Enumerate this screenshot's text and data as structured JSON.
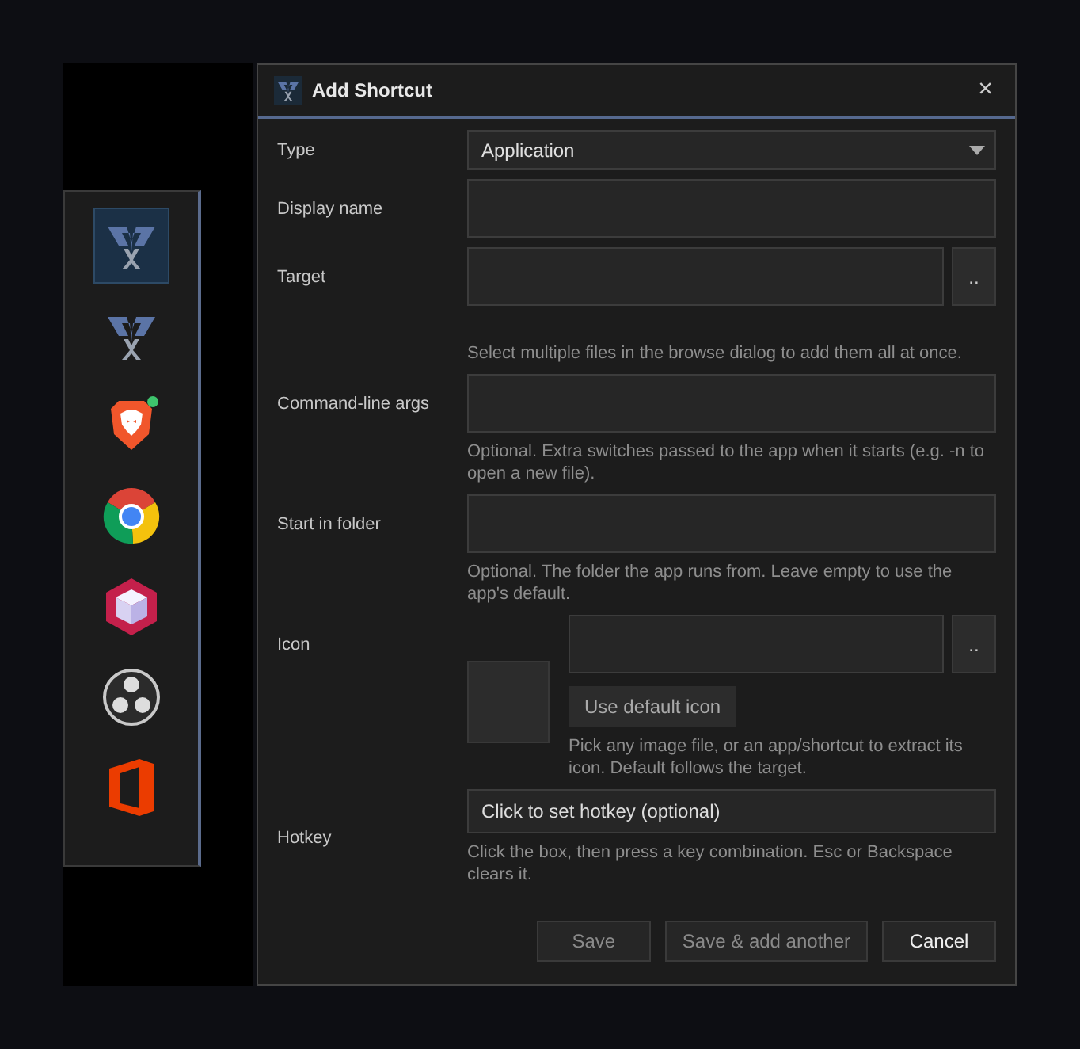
{
  "dock": {
    "items": [
      {
        "kind": "logo",
        "selected": true,
        "notification": false
      },
      {
        "kind": "logo",
        "selected": false,
        "notification": false
      },
      {
        "kind": "lion",
        "selected": false,
        "notification": true
      },
      {
        "kind": "chrome",
        "selected": false,
        "notification": false
      },
      {
        "kind": "cube",
        "selected": false,
        "notification": false
      },
      {
        "kind": "obs",
        "selected": false,
        "notification": false
      },
      {
        "kind": "office",
        "selected": false,
        "notification": false
      }
    ]
  },
  "dialog": {
    "title": "Add Shortcut",
    "close": "×",
    "fields": [
      {
        "kind": "select",
        "label": "Type",
        "value": "Application"
      },
      {
        "kind": "text",
        "label": "Display name"
      },
      {
        "kind": "browse",
        "label": "Target",
        "browse": "..",
        "hint": "Select multiple files in the browse dialog to add them all at once."
      },
      {
        "kind": "text",
        "label": "Command-line args",
        "hint": "Optional. Extra switches passed to the app when it starts (e.g. -n to open a new file)."
      },
      {
        "kind": "text",
        "label": "Start in folder",
        "hint": "Optional. The folder the app runs from. Leave empty to use the app's default."
      },
      {
        "kind": "icon",
        "label": "Icon",
        "browse": "..",
        "button": "Use default icon",
        "hint": "Pick any image file, or an app/shortcut to extract its icon. Default follows the target."
      },
      {
        "kind": "hotkey",
        "label": "Hotkey",
        "value": "Click to set hotkey (optional)",
        "hint": "Click the box, then press a key combination. Esc or Backspace clears it."
      }
    ],
    "buttons": [
      {
        "label": "Save",
        "disabled": true
      },
      {
        "label": "Save & add another",
        "disabled": true
      },
      {
        "label": "Cancel",
        "disabled": false
      }
    ]
  }
}
